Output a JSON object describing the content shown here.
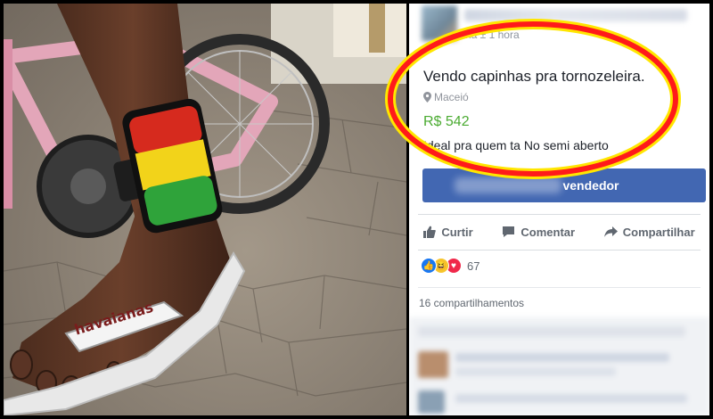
{
  "post": {
    "time": "há ± 1 hora",
    "title": "Vendo capinhas pra tornozeleira.",
    "location": "Maceió",
    "price": "R$ 542",
    "description": "Ideal pra quem ta No semi aberto",
    "seller_button_label": "vendedor"
  },
  "actions": {
    "like": "Curtir",
    "comment": "Comentar",
    "share": "Compartilhar"
  },
  "reactions": {
    "count": "67"
  },
  "shares": "16 compartilhamentos",
  "photo": {
    "flipflop_brand": "havaianas"
  },
  "colors": {
    "facebook_blue": "#4267b2",
    "price_green": "#4bab32",
    "highlight_red": "#ff1a1a",
    "highlight_yellow": "#ffe600"
  }
}
